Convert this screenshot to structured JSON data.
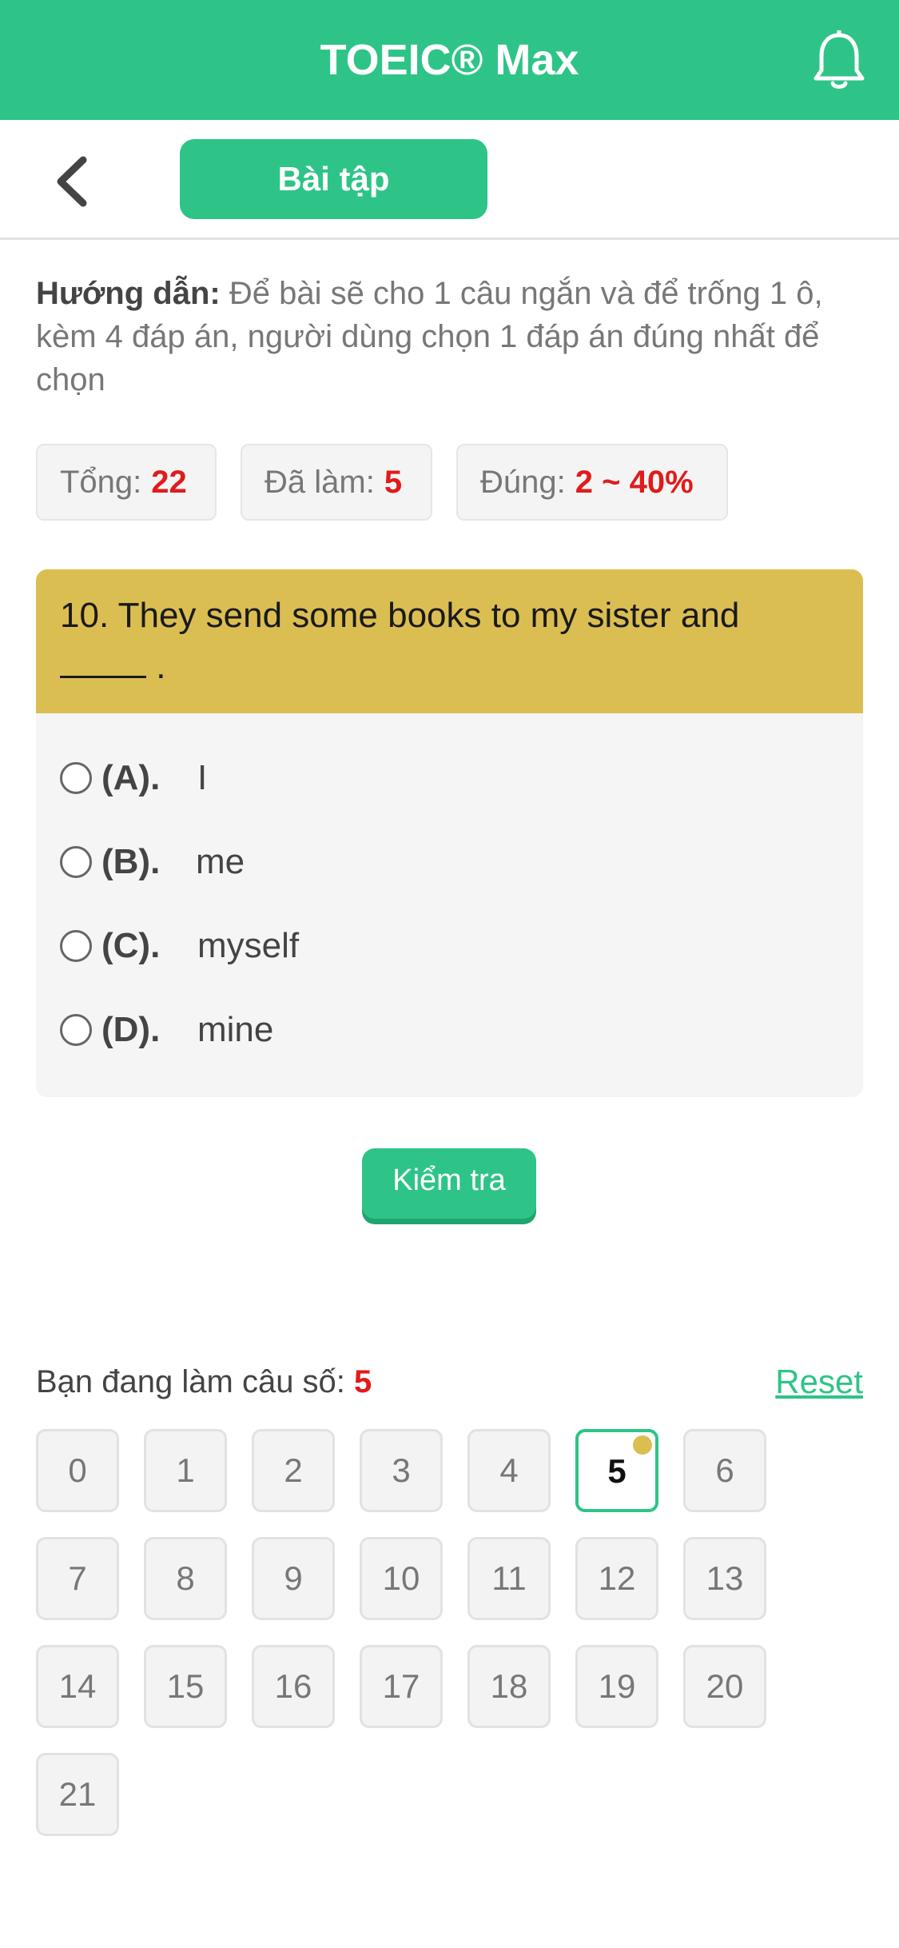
{
  "header": {
    "title": "TOEIC® Max",
    "notification_icon": "bell-icon",
    "brand_color": "#2ec487"
  },
  "subheader": {
    "back_icon": "chevron-left-icon",
    "tab_label": "Bài tập"
  },
  "instructions": {
    "label": "Hướng dẫn:",
    "text": "Để bài sẽ cho 1 câu ngắn và để trống 1 ô, kèm 4 đáp án, người dùng chọn 1 đáp án đúng nhất để chọn"
  },
  "stats": {
    "total_label": "Tổng:",
    "total_value": "22",
    "done_label": "Đã làm:",
    "done_value": "5",
    "correct_label": "Đúng:",
    "correct_value": "2 ~ 40%"
  },
  "question": {
    "text": "10. They send some books to my sister and",
    "suffix": ".",
    "highlight_color": "#dbbe52",
    "options": [
      {
        "letter": "(A).",
        "text": "I"
      },
      {
        "letter": "(B).",
        "text": "me"
      },
      {
        "letter": "(C).",
        "text": "myself"
      },
      {
        "letter": "(D).",
        "text": "mine"
      }
    ]
  },
  "check_button": "Kiểm tra",
  "progress": {
    "label": "Bạn đang làm câu số:",
    "current": "5",
    "reset_label": "Reset",
    "items": [
      "0",
      "1",
      "2",
      "3",
      "4",
      "5",
      "6",
      "7",
      "8",
      "9",
      "10",
      "11",
      "12",
      "13",
      "14",
      "15",
      "16",
      "17",
      "18",
      "19",
      "20",
      "21"
    ]
  }
}
